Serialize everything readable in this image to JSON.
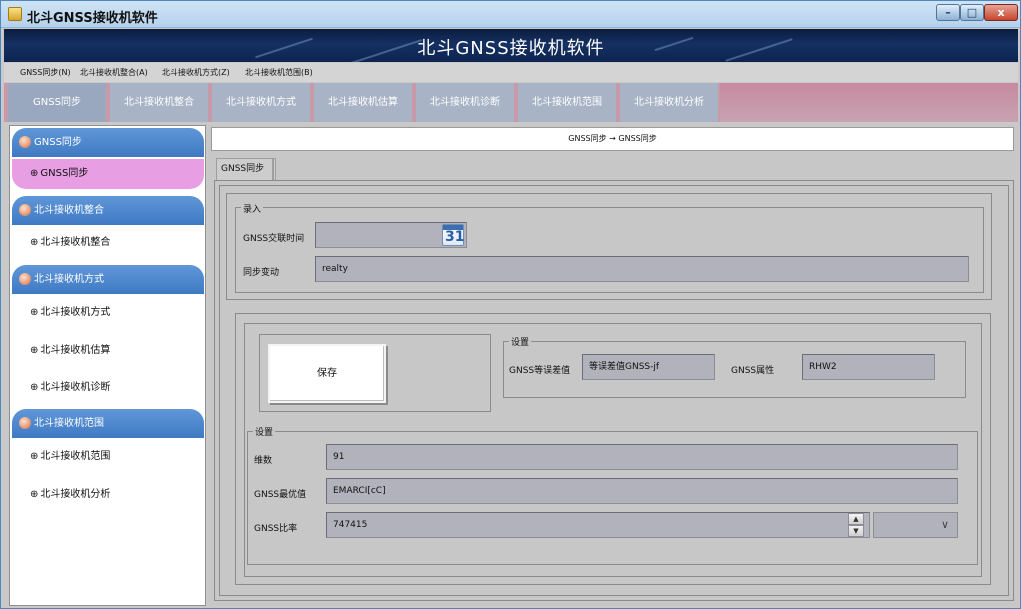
{
  "window": {
    "title": "北斗GNSS接收机软件",
    "controls": {
      "minimize": "–",
      "maximize": "□",
      "close": "x"
    }
  },
  "banner": {
    "title": "北斗GNSS接收机软件"
  },
  "menubar": [
    "GNSS同步(N)",
    "北斗接收机整合(A)",
    "北斗接收机方式(Z)",
    "北斗接收机范围(B)"
  ],
  "top_tabs": [
    "GNSS同步",
    "北斗接收机整合",
    "北斗接收机方式",
    "北斗接收机估算",
    "北斗接收机诊断",
    "北斗接收机范围",
    "北斗接收机分析"
  ],
  "sidebar": {
    "groups": [
      {
        "title": "GNSS同步",
        "items": [
          "GNSS同步"
        ]
      },
      {
        "title": "北斗接收机整合",
        "items": [
          "北斗接收机整合"
        ]
      },
      {
        "title": "北斗接收机方式",
        "items": [
          "北斗接收机方式",
          "北斗接收机估算",
          "北斗接收机诊断"
        ]
      },
      {
        "title": "北斗接收机范围",
        "items": [
          "北斗接收机范围",
          "北斗接收机分析"
        ]
      }
    ],
    "item_bullet": "⊕",
    "active_item": "GNSS同步"
  },
  "breadcrumb": "GNSS同步 → GNSS同步",
  "subtab": "GNSS同步",
  "form": {
    "input_group": {
      "legend": "录入",
      "time_label": "GNSS交联时间",
      "time_value": "",
      "calendar_day": "31",
      "sync_label": "同步变动",
      "sync_value": "realty"
    },
    "save_label": "保存",
    "settings_top": {
      "legend": "设置",
      "error_label": "GNSS等误差值",
      "error_value": "等误差值GNSS-jf",
      "attr_label": "GNSS属性",
      "attr_value": "RHW2"
    },
    "settings_bottom": {
      "legend": "设置",
      "dim_label": "维数",
      "dim_value": "91",
      "best_label": "GNSS最优值",
      "best_value": "EMARCI[cC]",
      "ratio_label": "GNSS比率",
      "ratio_value": "747415",
      "combo_value": ""
    }
  }
}
